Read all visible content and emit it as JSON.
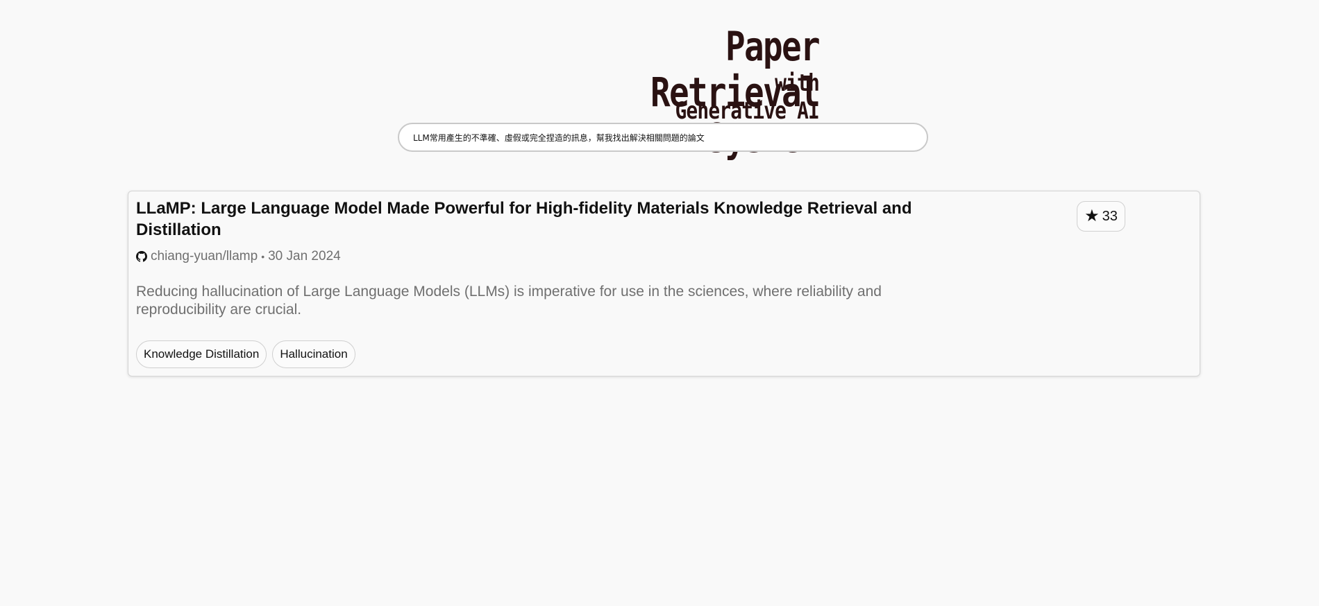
{
  "header": {
    "title": "Paper Retrieval System",
    "subtitle": "with Generative AI"
  },
  "search": {
    "value": "LLM常用產生的不準確、虛假或完全捏造的訊息，幫我找出解決相關問題的論文"
  },
  "results": [
    {
      "title": "LLaMP: Large Language Model Made Powerful for High-fidelity Materials Knowledge Retrieval and Distillation",
      "repo_icon": "github-icon",
      "repo": "chiang-yuan/llamp",
      "separator": "•",
      "date": "30 Jan 2024",
      "abstract": "Reducing hallucination of Large Language Models (LLMs) is imperative for use in the sciences, where reliability and reproducibility are crucial.",
      "tags": [
        "Knowledge Distillation",
        "Hallucination"
      ],
      "stars": "33",
      "star_icon": "star-icon"
    }
  ]
}
